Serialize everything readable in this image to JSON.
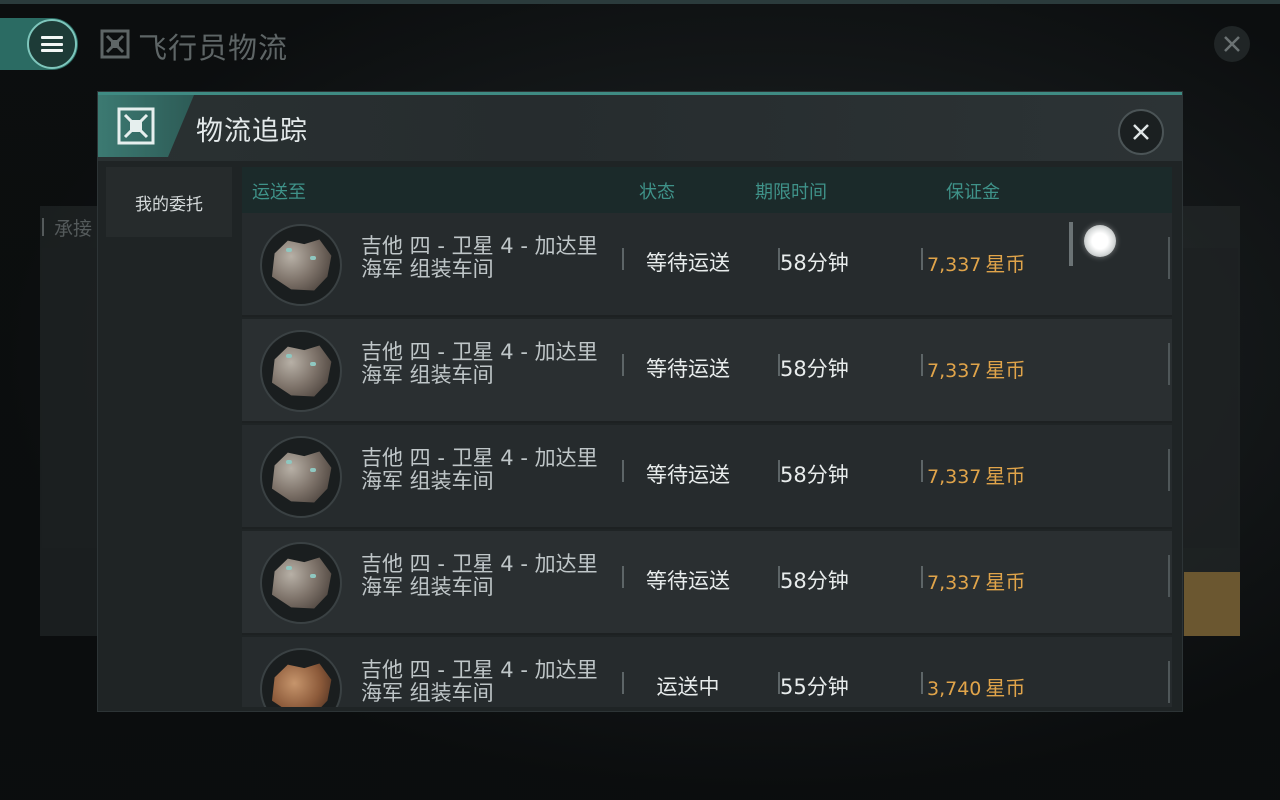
{
  "window": {
    "title": "飞行员物流",
    "bg_tab_label": "承接"
  },
  "dialog": {
    "title": "物流追踪",
    "sidebar": [
      {
        "label": "我的委托"
      }
    ],
    "columns": {
      "destination": "运送至",
      "status": "状态",
      "deadline": "期限时间",
      "deposit": "保证金"
    },
    "rows": [
      {
        "destination": "吉他 四 - 卫星 4 - 加达里海军 组装车间",
        "status": "等待运送",
        "deadline": "58分钟",
        "deposit": "7,337",
        "currency": "星币",
        "ore": "gray"
      },
      {
        "destination": "吉他 四 - 卫星 4 - 加达里海军 组装车间",
        "status": "等待运送",
        "deadline": "58分钟",
        "deposit": "7,337",
        "currency": "星币",
        "ore": "gray"
      },
      {
        "destination": "吉他 四 - 卫星 4 - 加达里海军 组装车间",
        "status": "等待运送",
        "deadline": "58分钟",
        "deposit": "7,337",
        "currency": "星币",
        "ore": "gray"
      },
      {
        "destination": "吉他 四 - 卫星 4 - 加达里海军 组装车间",
        "status": "等待运送",
        "deadline": "58分钟",
        "deposit": "7,337",
        "currency": "星币",
        "ore": "gray"
      },
      {
        "destination": "吉他 四 - 卫星 4 - 加达里海军 组装车间",
        "status": "运送中",
        "deadline": "55分钟",
        "deposit": "3,740",
        "currency": "星币",
        "ore": "brown"
      }
    ]
  },
  "colors": {
    "accent": "#3f8b83",
    "header_text": "#3f9289",
    "deposit": "#e0a44a"
  },
  "icons": {
    "menu": "hamburger-icon",
    "logistics": "logistics-icon",
    "close": "close-icon",
    "ore": "ore-icon"
  }
}
